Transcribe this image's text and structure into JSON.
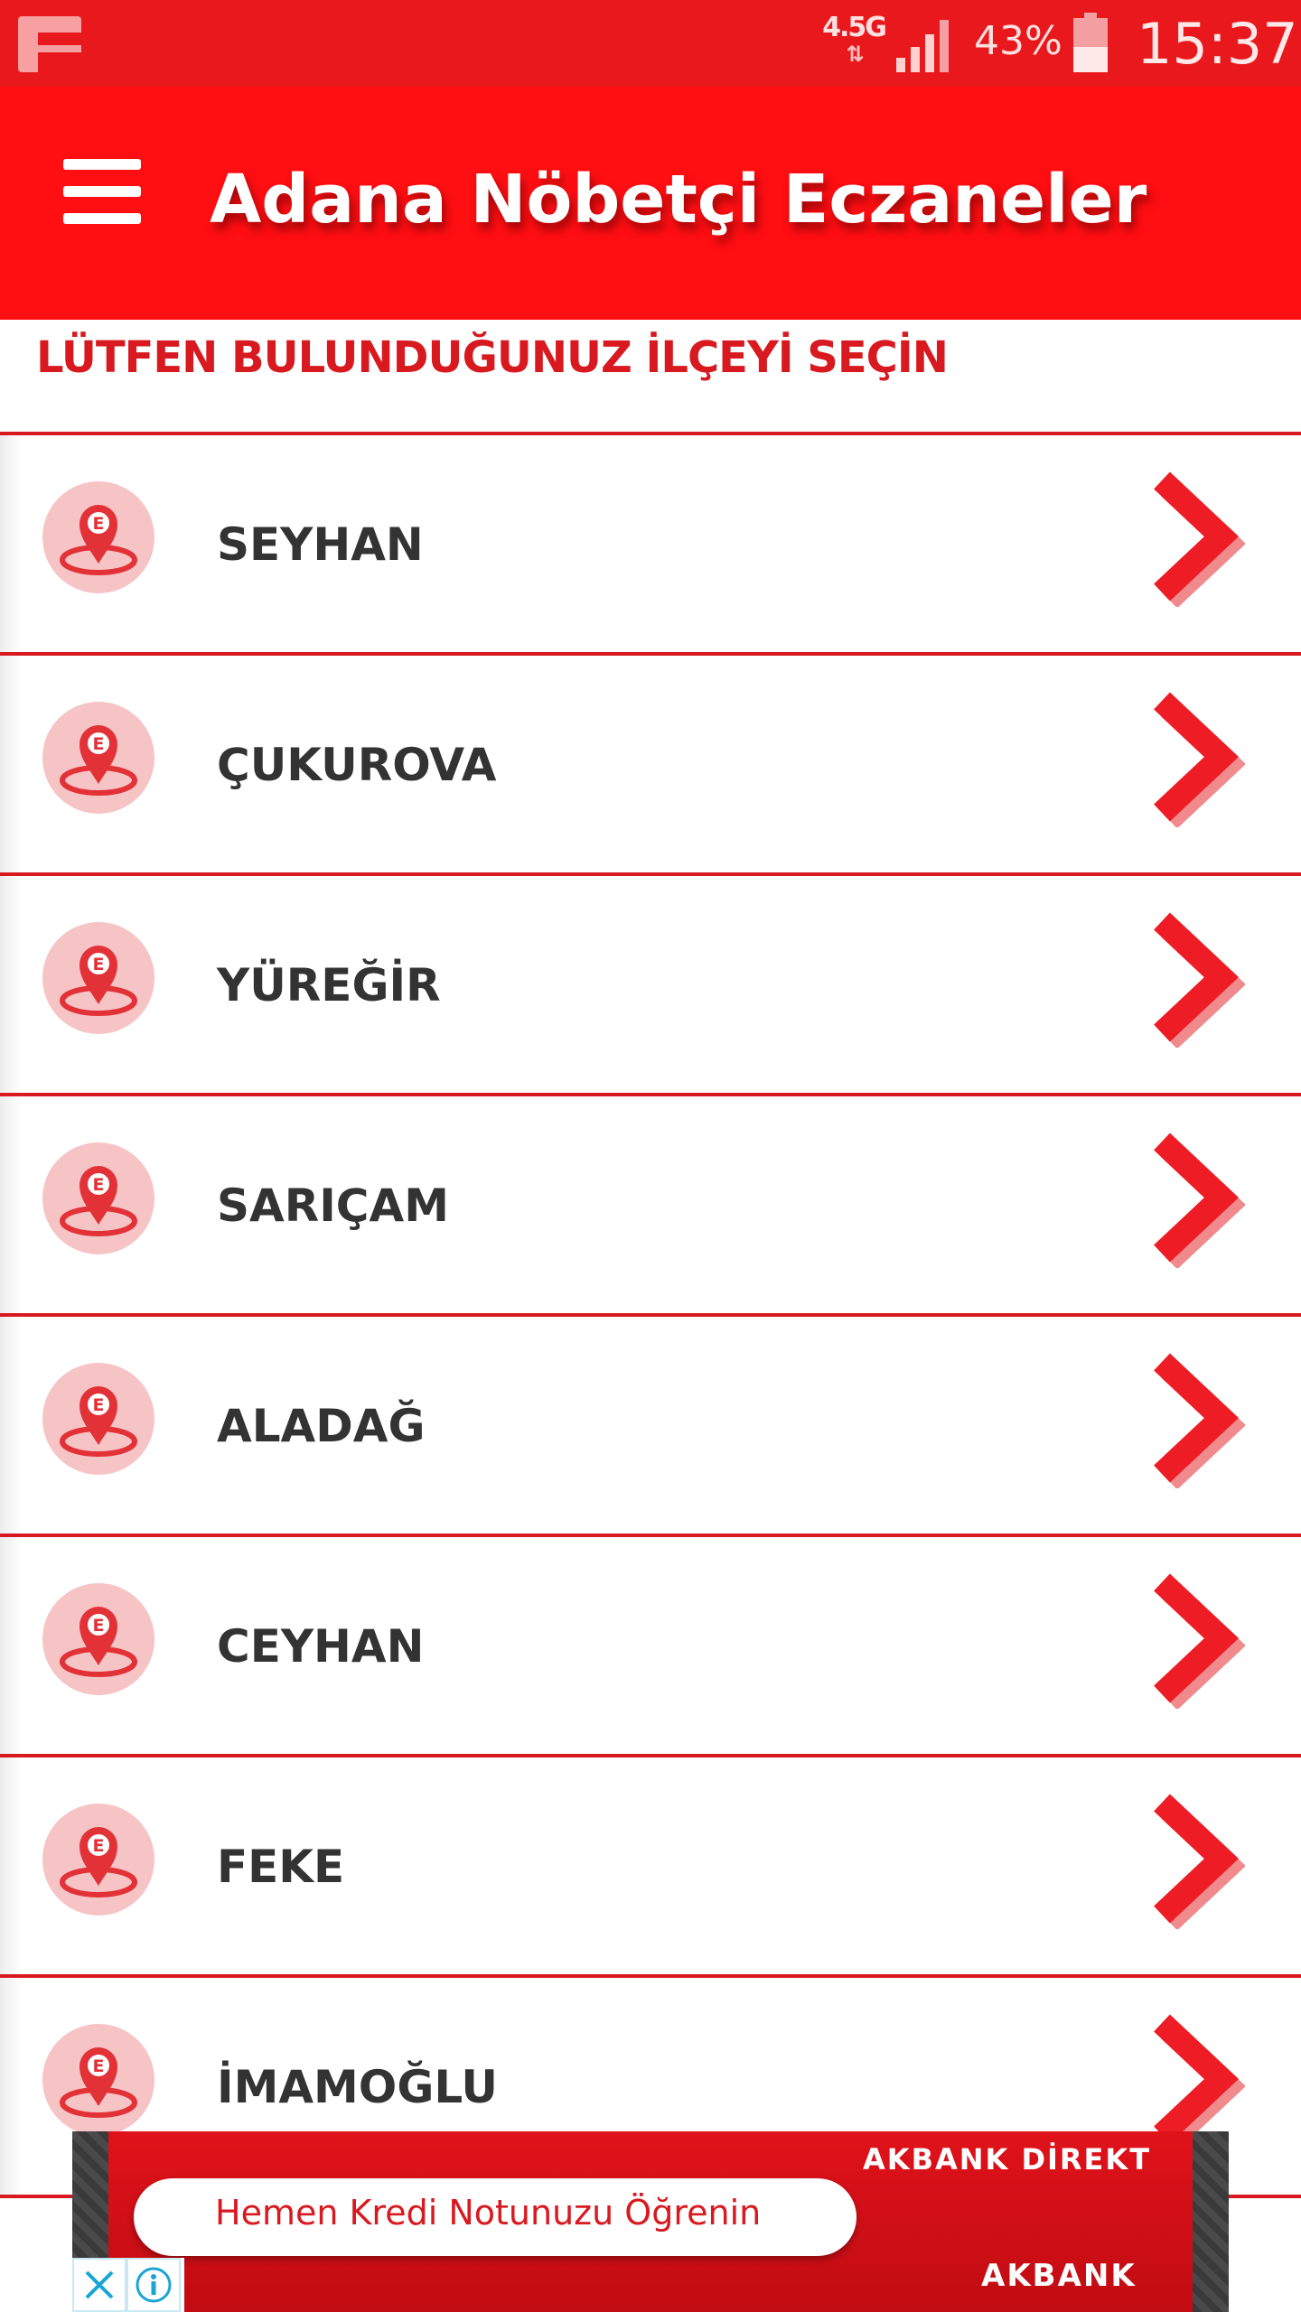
{
  "status_bar": {
    "network": "4.5G",
    "battery": "43%",
    "time": "15:37"
  },
  "app_bar": {
    "title": "Adana Nöbetçi Eczaneler"
  },
  "instruction": "LÜTFEN BULUNDUĞUNUZ İLÇEYİ SEÇİN",
  "districts": [
    {
      "name": "SEYHAN"
    },
    {
      "name": "ÇUKUROVA"
    },
    {
      "name": "YÜREĞİR"
    },
    {
      "name": "SARIÇAM"
    },
    {
      "name": "ALADAĞ"
    },
    {
      "name": "CEYHAN"
    },
    {
      "name": "FEKE"
    },
    {
      "name": "İMAMOĞLU"
    }
  ],
  "ad": {
    "brand_top": "AKBANK DİREKT",
    "cta": "Hemen Kredi Notunuzu Öğrenin",
    "brand_bottom": "AKBANK"
  },
  "icons": {
    "menu": "hamburger-menu-icon",
    "district": "pharmacy-location-pin-icon",
    "row_action": "chevron-right-icon",
    "ad_close": "close-icon",
    "ad_info": "info-icon"
  },
  "colors": {
    "primary": "#ff0e12",
    "status_bar": "#e8181c",
    "accent_text": "#d8191f",
    "item_text": "#333333"
  }
}
